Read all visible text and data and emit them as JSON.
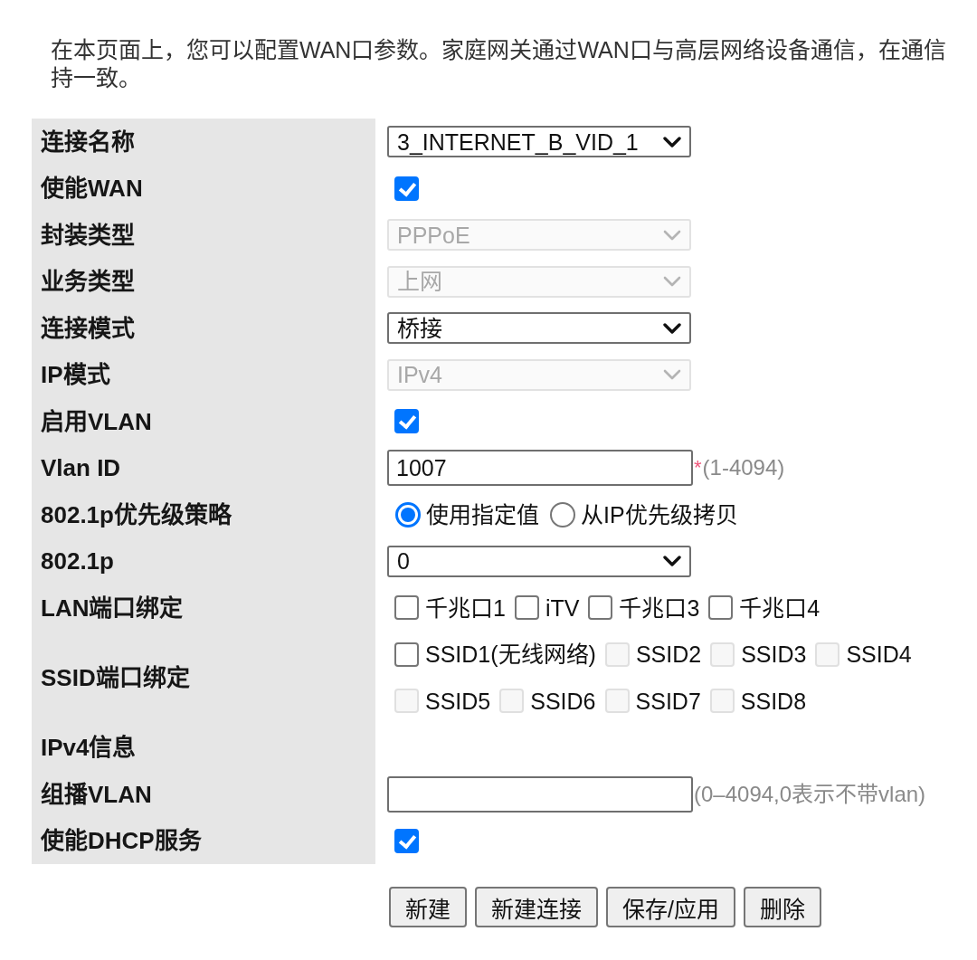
{
  "intro": [
    "在本页面上，您可以配置WAN口参数。家庭网关通过WAN口与高层网络设备通信，在通信",
    "持一致。"
  ],
  "form": {
    "rows": [
      {
        "label": "连接名称",
        "kind": "select",
        "value": "3_INTERNET_B_VID_1",
        "disabled": false
      },
      {
        "label": "使能WAN",
        "kind": "checkbox",
        "checked": true
      },
      {
        "label": "封装类型",
        "kind": "select",
        "value": "PPPoE",
        "disabled": true
      },
      {
        "label": "业务类型",
        "kind": "select",
        "value": "上网",
        "disabled": true
      },
      {
        "label": "连接模式",
        "kind": "select",
        "value": "桥接",
        "disabled": false
      },
      {
        "label": "IP模式",
        "kind": "select",
        "value": "IPv4",
        "disabled": true
      },
      {
        "label": "启用VLAN",
        "kind": "checkbox",
        "checked": true
      },
      {
        "label": "Vlan ID",
        "kind": "input",
        "value": "1007",
        "required_mark": "*",
        "hint": "(1-4094)"
      },
      {
        "label": "802.1p优先级策略",
        "kind": "radio",
        "options": [
          {
            "label": "使用指定值",
            "selected": true
          },
          {
            "label": "从IP优先级拷贝",
            "selected": false
          }
        ]
      },
      {
        "label": "802.1p",
        "kind": "select",
        "value": "0",
        "disabled": false
      },
      {
        "label": "LAN端口绑定",
        "kind": "checkbox_group",
        "lines": [
          [
            {
              "label": "千兆口1",
              "checked": false,
              "disabled": false
            },
            {
              "label": "iTV",
              "checked": false,
              "disabled": false
            },
            {
              "label": "千兆口3",
              "checked": false,
              "disabled": false
            },
            {
              "label": "千兆口4",
              "checked": false,
              "disabled": false
            }
          ]
        ]
      },
      {
        "label": "SSID端口绑定",
        "kind": "checkbox_group",
        "lines": [
          [
            {
              "label": "SSID1(无线网络)",
              "checked": false,
              "disabled": false
            },
            {
              "label": "SSID2",
              "checked": false,
              "disabled": true
            },
            {
              "label": "SSID3",
              "checked": false,
              "disabled": true
            },
            {
              "label": "SSID4",
              "checked": false,
              "disabled": true
            }
          ],
          [
            {
              "label": "SSID5",
              "checked": false,
              "disabled": true
            },
            {
              "label": "SSID6",
              "checked": false,
              "disabled": true
            },
            {
              "label": "SSID7",
              "checked": false,
              "disabled": true
            },
            {
              "label": "SSID8",
              "checked": false,
              "disabled": true
            }
          ]
        ]
      },
      {
        "label": "IPv4信息",
        "kind": "heading"
      },
      {
        "label": "组播VLAN",
        "kind": "input",
        "hint": "(0–4094,0表示不带vlan)"
      },
      {
        "label": "使能DHCP服务",
        "kind": "checkbox",
        "checked": true
      }
    ]
  },
  "buttons": [
    "新建",
    "新建连接",
    "保存/应用",
    "删除"
  ]
}
